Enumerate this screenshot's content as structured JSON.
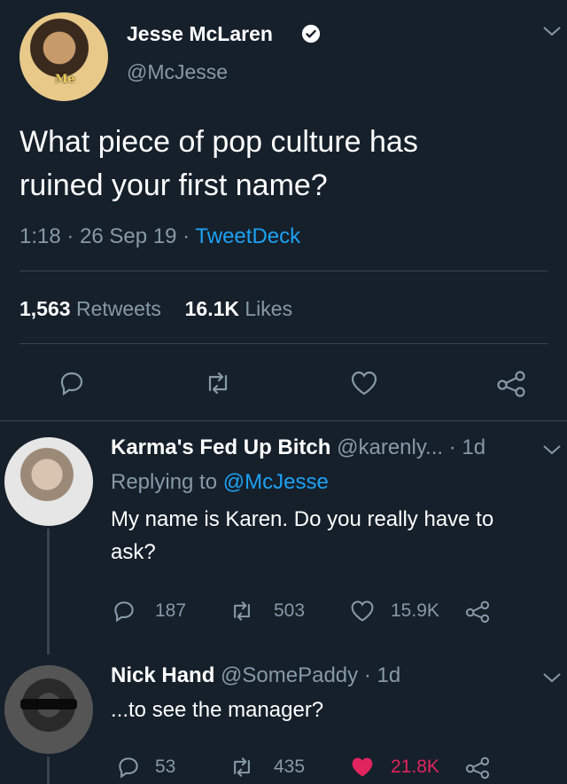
{
  "tweet": {
    "author_name": "Jesse McLaren",
    "author_handle": "@McJesse",
    "avatar_caption": "Me",
    "text_line1": "What piece of pop culture has",
    "text_line2": "ruined your first name?",
    "time": "1:18",
    "date": "26 Sep 19",
    "source": "TweetDeck",
    "sep": "·",
    "retweets_count": "1,563",
    "retweets_label": "Retweets",
    "likes_count": "16.1K",
    "likes_label": "Likes"
  },
  "replies": [
    {
      "name": "Karma's Fed Up Bitch",
      "handle": "@karenly...",
      "age": "· 1d",
      "replying_prefix": "Replying to",
      "replying_handle": "@McJesse",
      "text_line1": "My name is Karen. Do you really have to",
      "text_line2": "ask?",
      "replies": "187",
      "retweets": "503",
      "likes": "15.9K",
      "liked": false
    },
    {
      "name": "Nick Hand",
      "handle": "@SomePaddy",
      "age": "· 1d",
      "text_line1": "...to see the manager?",
      "replies": "53",
      "retweets": "435",
      "likes": "21.8K",
      "liked": true
    }
  ],
  "icons": {
    "reply": "reply-icon",
    "retweet": "retweet-icon",
    "like": "heart-icon",
    "share": "share-icon",
    "verified": "verified-badge-icon",
    "more": "chevron-down-icon"
  },
  "colors": {
    "background": "#15202b",
    "link": "#1da1f2",
    "muted": "#8899a6",
    "like_active": "#e0245e"
  }
}
